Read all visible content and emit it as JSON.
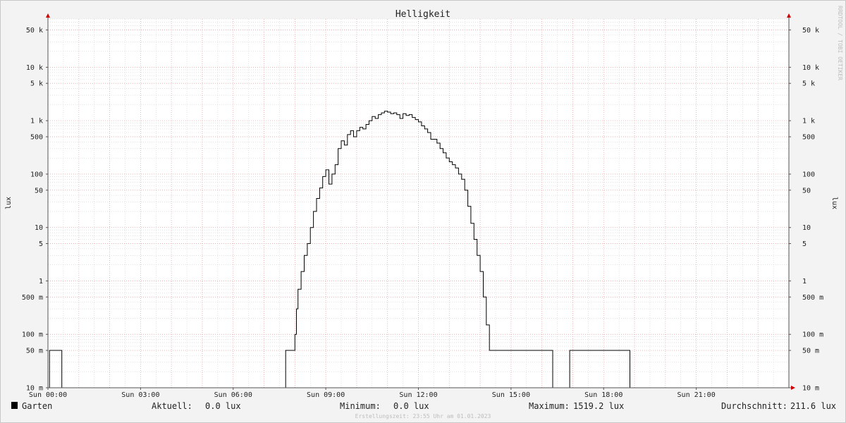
{
  "chart_data": {
    "type": "line",
    "title": "Helligkeit",
    "ylabel": "lux",
    "ylabel_right": "lux",
    "y_scale": "log",
    "ylim": [
      0.01,
      80000
    ],
    "x_ticks": [
      {
        "label": "Sun 00:00",
        "hour": 0
      },
      {
        "label": "Sun 03:00",
        "hour": 3
      },
      {
        "label": "Sun 06:00",
        "hour": 6
      },
      {
        "label": "Sun 09:00",
        "hour": 9
      },
      {
        "label": "Sun 12:00",
        "hour": 12
      },
      {
        "label": "Sun 15:00",
        "hour": 15
      },
      {
        "label": "Sun 18:00",
        "hour": 18
      },
      {
        "label": "Sun 21:00",
        "hour": 21
      }
    ],
    "y_ticks": [
      {
        "label": "10 m",
        "value": 0.01
      },
      {
        "label": "50 m",
        "value": 0.05
      },
      {
        "label": "100 m",
        "value": 0.1
      },
      {
        "label": "500 m",
        "value": 0.5
      },
      {
        "label": "1",
        "value": 1
      },
      {
        "label": "5",
        "value": 5
      },
      {
        "label": "10",
        "value": 10
      },
      {
        "label": "50",
        "value": 50
      },
      {
        "label": "100",
        "value": 100
      },
      {
        "label": "500",
        "value": 500
      },
      {
        "label": "1 k",
        "value": 1000
      },
      {
        "label": "5 k",
        "value": 5000
      },
      {
        "label": "10 k",
        "value": 10000
      },
      {
        "label": "50 k",
        "value": 50000
      }
    ],
    "series": [
      {
        "name": "Garten",
        "color": "#000000",
        "x": [
          0.0,
          0.05,
          0.45,
          7.7,
          8.0,
          8.05,
          8.1,
          8.2,
          8.3,
          8.4,
          8.5,
          8.6,
          8.7,
          8.8,
          8.9,
          9.0,
          9.1,
          9.2,
          9.3,
          9.4,
          9.5,
          9.6,
          9.7,
          9.8,
          9.9,
          10.0,
          10.1,
          10.2,
          10.3,
          10.4,
          10.5,
          10.6,
          10.7,
          10.8,
          10.9,
          11.0,
          11.1,
          11.2,
          11.3,
          11.4,
          11.5,
          11.6,
          11.7,
          11.8,
          11.9,
          12.0,
          12.1,
          12.2,
          12.3,
          12.4,
          12.5,
          12.6,
          12.7,
          12.8,
          12.9,
          13.0,
          13.1,
          13.2,
          13.3,
          13.4,
          13.5,
          13.6,
          13.7,
          13.8,
          13.9,
          14.0,
          14.1,
          14.2,
          14.3,
          14.4,
          14.5,
          14.6,
          14.7,
          14.8,
          14.9,
          15.0,
          15.1,
          15.2,
          15.3,
          15.4,
          15.5,
          15.6,
          15.7,
          15.8,
          15.9,
          16.0,
          16.1,
          16.2,
          16.3,
          16.4,
          16.5,
          16.6,
          16.7,
          16.8,
          16.9,
          17.0,
          17.1,
          17.2,
          17.3,
          17.4,
          17.5,
          18.1,
          18.65,
          20.6,
          20.7,
          23.95
        ],
        "y": [
          0.01,
          0.05,
          0.01,
          0.05,
          0.1,
          0.3,
          1,
          3,
          5,
          10,
          20,
          40,
          60,
          100,
          120,
          60,
          100,
          150,
          300,
          400,
          500,
          300,
          600,
          700,
          500,
          700,
          800,
          900,
          1000,
          1200,
          1100,
          1300,
          1400,
          1500,
          1500,
          1400,
          1300,
          1500,
          1200,
          1300,
          1000,
          1300,
          1200,
          1300,
          1100,
          1000,
          900,
          800,
          700,
          500,
          400,
          500,
          400,
          300,
          250,
          200,
          170,
          150,
          130,
          100,
          60,
          30,
          15,
          8,
          4,
          2,
          0.5,
          0.1,
          0.05,
          0.05,
          0.05,
          0.05,
          0.05,
          0.05,
          0.01,
          0.05,
          0.05,
          0.01
        ],
        "y_note": "",
        "data": [
          [
            0.0,
            0.01
          ],
          [
            0.05,
            0.05
          ],
          [
            0.45,
            0.01
          ],
          [
            7.7,
            0.05
          ],
          [
            8.0,
            0.1
          ],
          [
            8.05,
            0.3
          ],
          [
            8.1,
            0.7
          ],
          [
            8.2,
            1.5
          ],
          [
            8.3,
            3
          ],
          [
            8.4,
            5
          ],
          [
            8.5,
            10
          ],
          [
            8.6,
            20
          ],
          [
            8.7,
            35
          ],
          [
            8.8,
            55
          ],
          [
            8.9,
            90
          ],
          [
            9.0,
            120
          ],
          [
            9.1,
            65
          ],
          [
            9.2,
            100
          ],
          [
            9.3,
            150
          ],
          [
            9.4,
            300
          ],
          [
            9.5,
            420
          ],
          [
            9.6,
            350
          ],
          [
            9.7,
            550
          ],
          [
            9.8,
            650
          ],
          [
            9.9,
            500
          ],
          [
            10.0,
            650
          ],
          [
            10.1,
            750
          ],
          [
            10.2,
            700
          ],
          [
            10.3,
            850
          ],
          [
            10.4,
            1000
          ],
          [
            10.5,
            1200
          ],
          [
            10.6,
            1100
          ],
          [
            10.7,
            1300
          ],
          [
            10.8,
            1400
          ],
          [
            10.9,
            1500
          ],
          [
            11.0,
            1450
          ],
          [
            11.1,
            1350
          ],
          [
            11.2,
            1400
          ],
          [
            11.3,
            1300
          ],
          [
            11.4,
            1100
          ],
          [
            11.5,
            1350
          ],
          [
            11.6,
            1250
          ],
          [
            11.7,
            1300
          ],
          [
            11.8,
            1150
          ],
          [
            11.9,
            1050
          ],
          [
            12.0,
            950
          ],
          [
            12.1,
            800
          ],
          [
            12.2,
            700
          ],
          [
            12.3,
            600
          ],
          [
            12.4,
            450
          ],
          [
            12.5,
            450
          ],
          [
            12.6,
            380
          ],
          [
            12.7,
            300
          ],
          [
            12.8,
            250
          ],
          [
            12.9,
            200
          ],
          [
            13.0,
            170
          ],
          [
            13.1,
            150
          ],
          [
            13.2,
            130
          ],
          [
            13.3,
            100
          ],
          [
            13.4,
            80
          ],
          [
            13.5,
            50
          ],
          [
            13.6,
            25
          ],
          [
            13.7,
            12
          ],
          [
            13.8,
            6
          ],
          [
            13.9,
            3
          ],
          [
            14.0,
            1.5
          ],
          [
            14.1,
            0.5
          ],
          [
            14.2,
            0.15
          ],
          [
            14.3,
            0.05
          ],
          [
            16.3,
            0.05
          ],
          [
            16.35,
            0.01
          ],
          [
            16.85,
            0.01
          ],
          [
            16.9,
            0.05
          ],
          [
            18.8,
            0.05
          ],
          [
            18.85,
            0.01
          ],
          [
            23.95,
            0.01
          ]
        ]
      }
    ],
    "legend": {
      "name": "Garten",
      "aktuell_label": "Aktuell:",
      "aktuell_value": "0.0 lux",
      "minimum_label": "Minimum:",
      "minimum_value": "0.0 lux",
      "maximum_label": "Maximum:",
      "maximum_value": "1519.2 lux",
      "avg_label": "Durchschnitt:",
      "avg_value": "211.6 lux"
    },
    "footer": "Erstellungszeit: 23:55 Uhr am 01.01.2023",
    "watermark": "RRDTOOL / TOBI OETIKER",
    "colors": {
      "grid_major": "#e8a0a0",
      "grid_minor": "#d0d0d0",
      "line": "#000000",
      "axis": "#cc0000",
      "plot_bg": "#ffffff",
      "page_bg": "#f3f3f3"
    }
  }
}
